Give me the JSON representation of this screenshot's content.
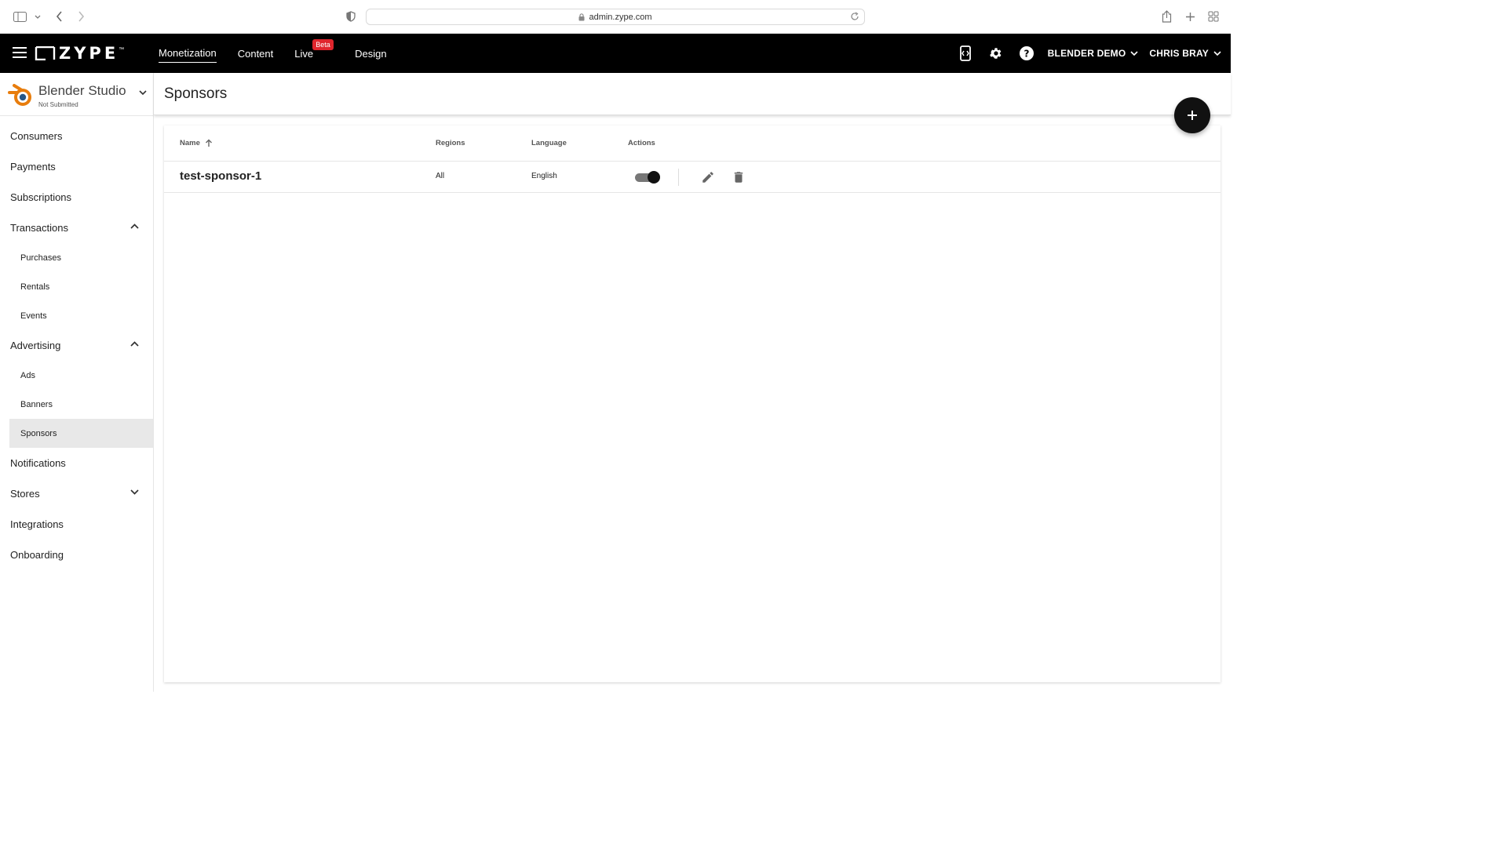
{
  "browser": {
    "url": "admin.zype.com"
  },
  "header": {
    "logo_text": "ZYPE",
    "logo_tm": "™",
    "nav": [
      {
        "label": "Monetization"
      },
      {
        "label": "Content"
      },
      {
        "label": "Live"
      },
      {
        "label": "Design"
      }
    ],
    "beta_badge": "Beta",
    "account_menu": "BLENDER DEMO",
    "user_menu": "CHRIS BRAY"
  },
  "sidebar": {
    "studio_name": "Blender Studio",
    "studio_status": "Not Submitted",
    "items": {
      "consumers": "Consumers",
      "payments": "Payments",
      "subscriptions": "Subscriptions",
      "transactions": "Transactions",
      "purchases": "Purchases",
      "rentals": "Rentals",
      "events": "Events",
      "advertising": "Advertising",
      "ads": "Ads",
      "banners": "Banners",
      "sponsors": "Sponsors",
      "notifications": "Notifications",
      "stores": "Stores",
      "integrations": "Integrations",
      "onboarding": "Onboarding"
    }
  },
  "page": {
    "title": "Sponsors"
  },
  "table": {
    "columns": {
      "name": "Name",
      "regions": "Regions",
      "language": "Language",
      "actions": "Actions"
    },
    "rows": [
      {
        "name": "test-sponsor-1",
        "regions": "All",
        "language": "English",
        "enabled": true
      }
    ]
  },
  "colors": {
    "header_bg": "#000000",
    "beta_badge": "#e0262d",
    "blender_orange": "#e87d0d",
    "blender_blue": "#265787"
  }
}
